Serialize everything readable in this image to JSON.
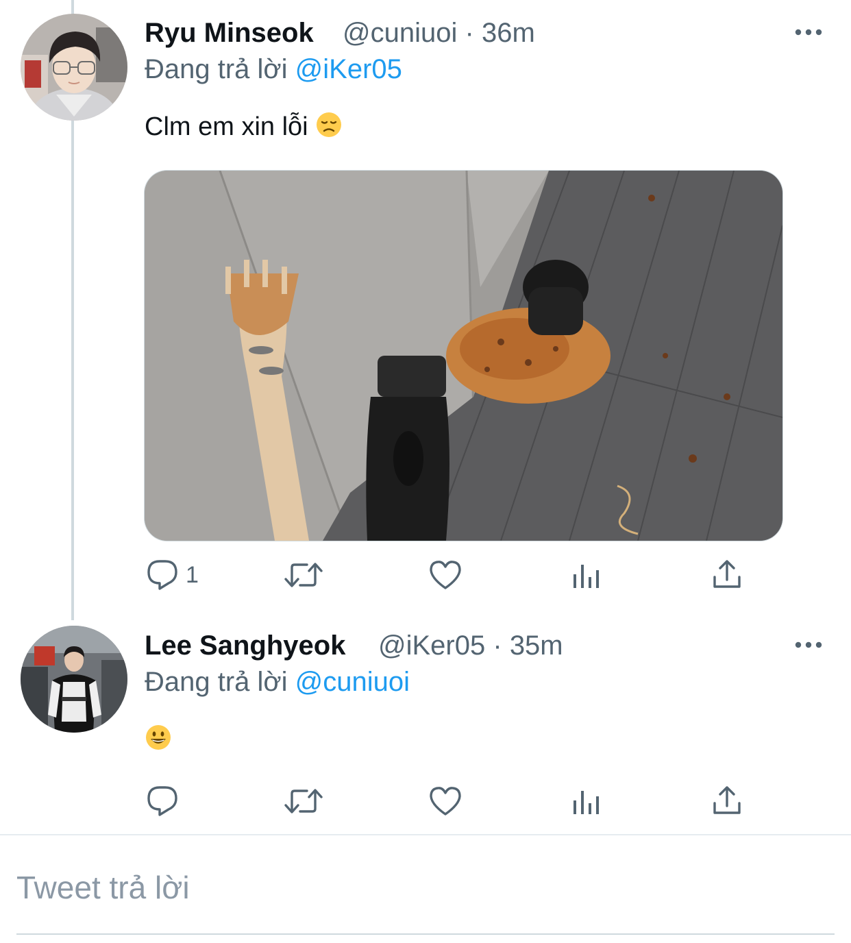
{
  "tweets": [
    {
      "name": "Ryu Minseok",
      "handle": "@cuniuoi",
      "separator": "·",
      "time": "36m",
      "replying_prefix": "Đang trả lời",
      "replying_to": "@iKer05",
      "text": "Clm em xin lỗi",
      "emoji": "disappointed-face",
      "has_media": true,
      "reply_count": "1",
      "actions": [
        "reply",
        "retweet",
        "like",
        "analytics",
        "share"
      ]
    },
    {
      "name": "Lee Sanghyeok",
      "handle": "@iKer05",
      "separator": "·",
      "time": "35m",
      "replying_prefix": "Đang trả lời",
      "replying_to": "@cuniuoi",
      "text": "",
      "emoji": "grinning-face",
      "has_media": false,
      "reply_count": "",
      "actions": [
        "reply",
        "retweet",
        "like",
        "analytics",
        "share"
      ]
    }
  ],
  "reply_box": {
    "placeholder": "Tweet trả lời"
  },
  "colors": {
    "link": "#1d9bf0",
    "secondary_text": "#536471",
    "icon": "#536471",
    "thread_line": "#cfd9de"
  }
}
